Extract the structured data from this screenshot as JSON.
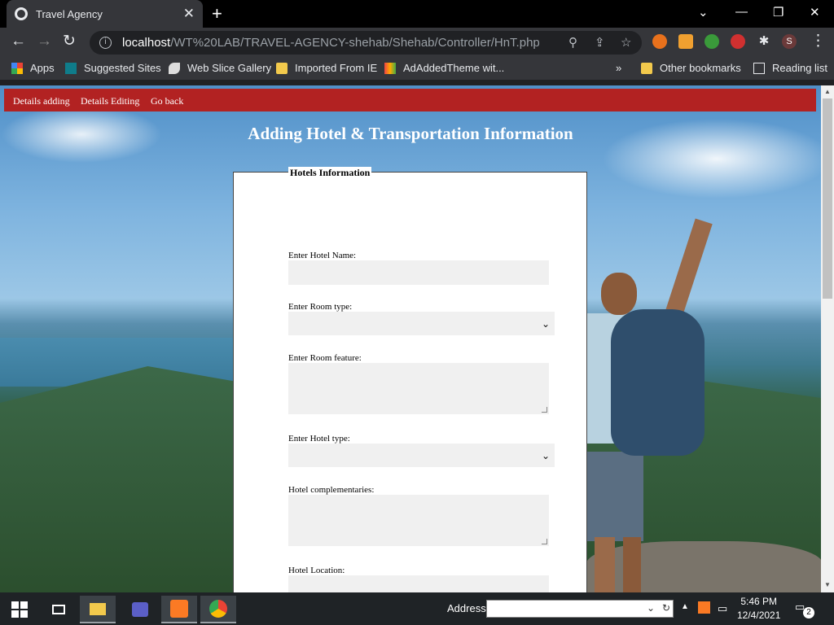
{
  "browser": {
    "tab_title": "Travel Agency",
    "url_host": "localhost",
    "url_path": "/WT%20LAB/TRAVEL-AGENCY-shehab/Shehab/Controller/HnT.php",
    "profile_initial": "S",
    "bookmarks": [
      "Apps",
      "Suggested Sites",
      "Web Slice Gallery",
      "Imported From IE",
      "AdAddedTheme wit...",
      "Other bookmarks",
      "Reading list"
    ],
    "overflow": "»"
  },
  "nav": {
    "items": [
      "Details adding",
      "Details Editing",
      "Go back"
    ]
  },
  "page": {
    "heading": "Adding Hotel & Transportation Information",
    "legend": "Hotels Information",
    "fields": {
      "hotel_name": "Enter Hotel Name:",
      "room_type": "Enter Room type:",
      "room_feature": "Enter Room feature:",
      "hotel_type": "Enter Hotel type:",
      "complementaries": "Hotel complementaries:",
      "location": "Hotel Location:"
    }
  },
  "taskbar": {
    "address_label": "Address",
    "time": "5:46 PM",
    "date": "12/4/2021",
    "notification_count": "2"
  },
  "colors": {
    "nav_bg": "#b22222",
    "chrome_dark": "#202124",
    "chrome_toolbar": "#35363a"
  }
}
